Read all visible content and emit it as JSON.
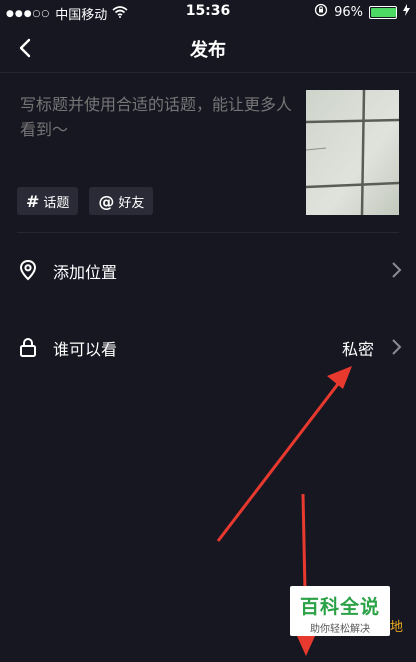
{
  "status_bar": {
    "signal": "●●●○○",
    "carrier": "中国移动",
    "time": "15:36",
    "battery_percent": "96%",
    "battery_level": 0.96
  },
  "nav": {
    "title": "发布"
  },
  "caption": {
    "placeholder": "写标题并使用合适的话题，能让更多人看到～"
  },
  "chips": {
    "topic_symbol": "#",
    "topic_label": "话题",
    "mention_symbol": "@",
    "mention_label": "好友"
  },
  "settings": {
    "location_label": "添加位置",
    "visibility_label": "谁可以看",
    "visibility_value": "私密"
  },
  "watermark": {
    "title": "百科全说",
    "subtitle": "助你轻松解决",
    "tail_text": "地"
  },
  "colors": {
    "background": "#171722",
    "arrow": "#e8392f",
    "watermark_green": "#2ba246"
  }
}
